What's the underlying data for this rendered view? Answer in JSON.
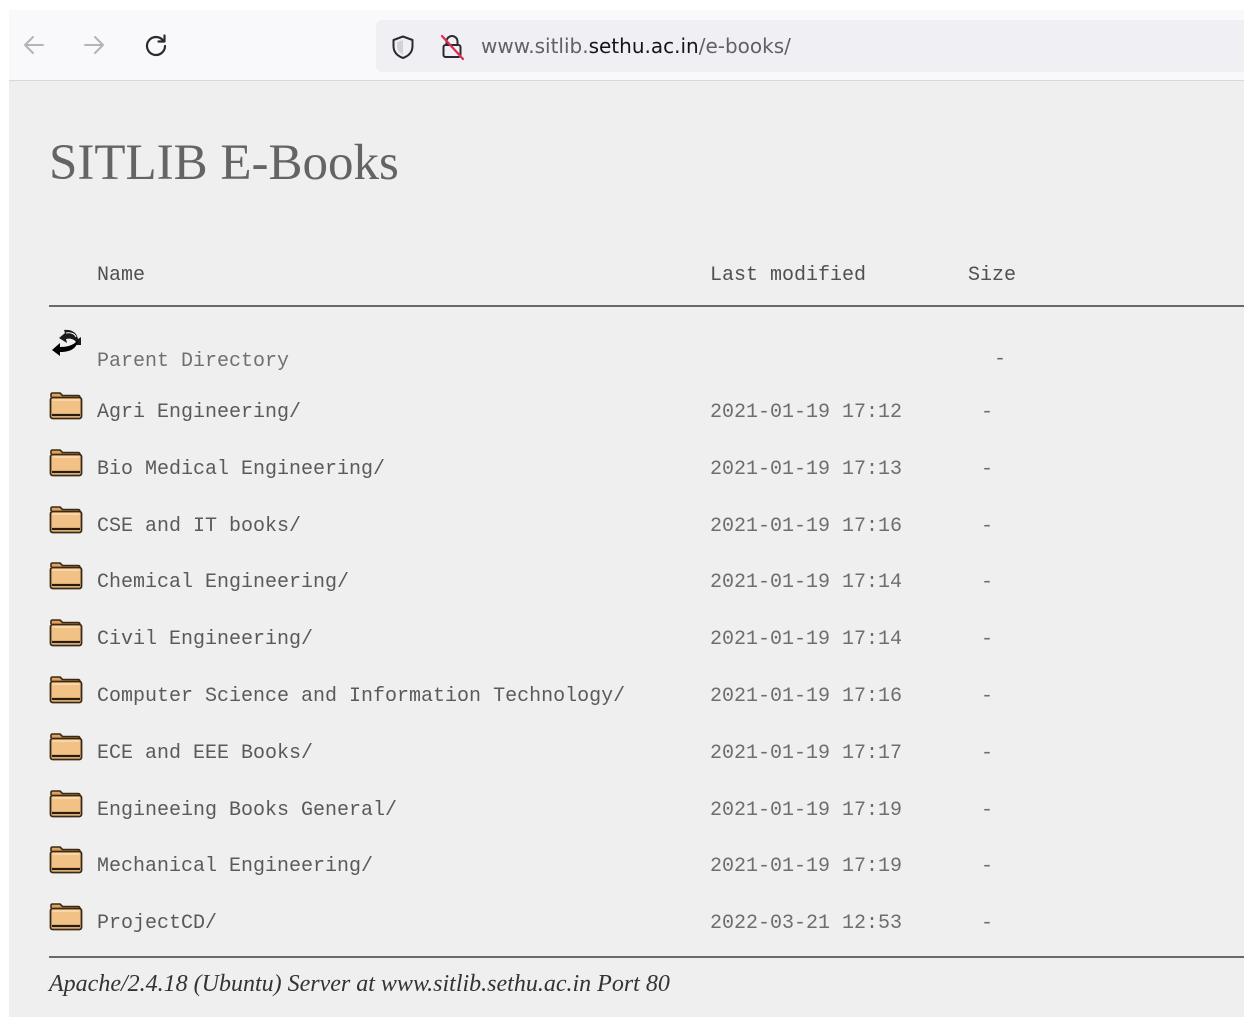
{
  "browser": {
    "url_prefix": "www.sitlib.",
    "url_host": "sethu.ac.in",
    "url_path": "/e-books/",
    "icons": {
      "back": "arrow-left-icon",
      "forward": "arrow-right-icon",
      "reload": "reload-icon",
      "tracking": "shield-icon",
      "security": "insecure-lock-icon"
    }
  },
  "page": {
    "title": "SITLIB E-Books",
    "columns": {
      "name": "Name",
      "modified": "Last modified",
      "size": "Size"
    },
    "parent": {
      "label": "Parent Directory",
      "size": "-",
      "icon": "back-arrow-icon"
    },
    "entries": [
      {
        "name": "Agri Engineering/",
        "modified": "2021-01-19 17:12",
        "size": "-",
        "icon": "folder-icon"
      },
      {
        "name": "Bio Medical Engineering/",
        "modified": "2021-01-19 17:13",
        "size": "-",
        "icon": "folder-icon"
      },
      {
        "name": "CSE and IT books/",
        "modified": "2021-01-19 17:16",
        "size": "-",
        "icon": "folder-icon"
      },
      {
        "name": "Chemical Engineering/",
        "modified": "2021-01-19 17:14",
        "size": "-",
        "icon": "folder-icon"
      },
      {
        "name": "Civil Engineering/",
        "modified": "2021-01-19 17:14",
        "size": "-",
        "icon": "folder-icon"
      },
      {
        "name": "Computer Science and Information Technology/",
        "modified": "2021-01-19 17:16",
        "size": "-",
        "icon": "folder-icon"
      },
      {
        "name": "ECE and EEE Books/",
        "modified": "2021-01-19 17:17",
        "size": "-",
        "icon": "folder-icon"
      },
      {
        "name": "Engineeing Books General/",
        "modified": "2021-01-19 17:19",
        "size": "-",
        "icon": "folder-icon"
      },
      {
        "name": "Mechanical Engineering/",
        "modified": "2021-01-19 17:19",
        "size": "-",
        "icon": "folder-icon"
      },
      {
        "name": "ProjectCD/",
        "modified": "2022-03-21 12:53",
        "size": "-",
        "icon": "folder-icon"
      }
    ],
    "footer": "Apache/2.4.18 (Ubuntu) Server at www.sitlib.sethu.ac.in Port 80"
  },
  "colors": {
    "page_background": "#efefef",
    "toolbar_background": "#f9f9fb",
    "folder_fill": "#f2c185",
    "title_text": "#646464"
  }
}
